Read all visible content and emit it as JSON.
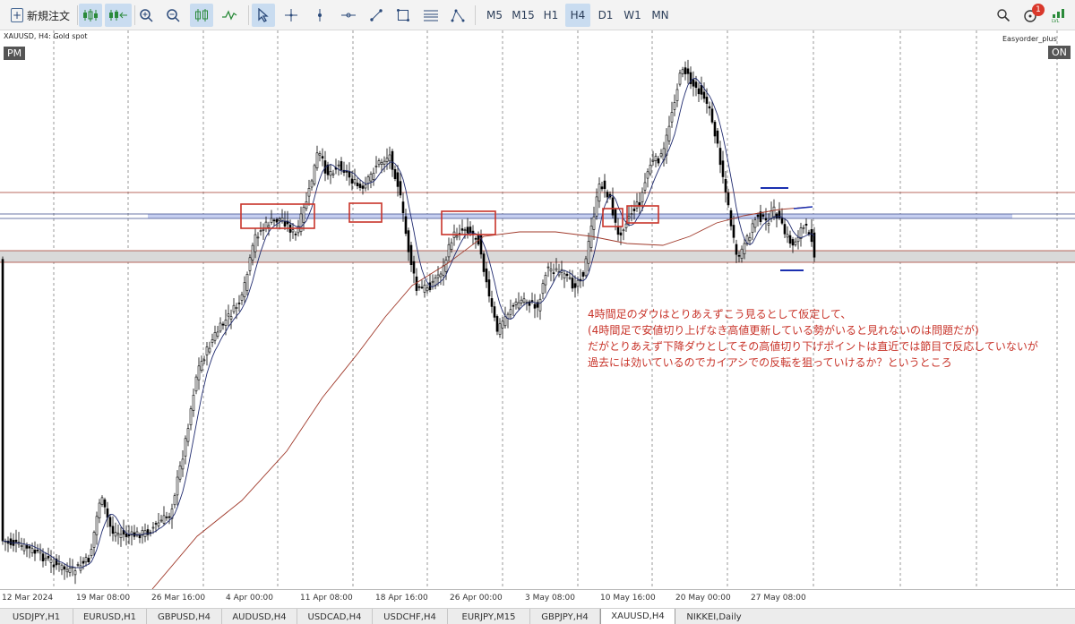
{
  "toolbar": {
    "new_order_label": "新規注文",
    "timeframes": [
      "M5",
      "M15",
      "H1",
      "H4",
      "D1",
      "W1",
      "MN"
    ],
    "active_timeframe": "H4",
    "notification_count": "1",
    "tools": [
      "depth-of-market-icon",
      "one-click-trading-icon",
      "zoom-in-icon",
      "zoom-out-icon",
      "candlestick-icon",
      "line-chart-icon",
      "cursor-icon",
      "crosshair-icon",
      "vertical-line-icon",
      "horizontal-line-icon",
      "trendline-icon",
      "rectangle-icon",
      "fibonacci-icon",
      "shapes-icon",
      "search-icon",
      "notifications-icon",
      "signal-strength-icon"
    ]
  },
  "chart": {
    "symbol_label": "XAUUSD, H4:  Gold spot",
    "pm_badge": "PM",
    "on_badge": "ON",
    "ea_label": "Easyorder_plus",
    "annotation": [
      "4時間足のダウはとりあえずこう見るとして仮定して、",
      "(4時間足で安値切り上げなき高値更新している勢がいると見れないのは問題だが)",
      "だがとりあえず下降ダウとしてその高値切り下げポイントは直近では節目で反応していないが",
      "過去には効いているのでカイアシでの反転を狙っていけるか？というところ"
    ],
    "dates": [
      "12 Mar 2024",
      "19 Mar 08:00",
      "26 Mar 16:00",
      "4 Apr 00:00",
      "11 Apr 08:00",
      "18 Apr 16:00",
      "26 Apr 00:00",
      "3 May 08:00",
      "10 May 16:00",
      "20 May 00:00",
      "27 May 08:00"
    ],
    "colors": {
      "candle": "#000000",
      "ma_fast": "#1f2a6e",
      "ma_slow": "#a0392a",
      "annotation": "#c8342a",
      "zone_blue": "#c6cff0",
      "zone_gray": "#d9d9d9"
    }
  },
  "tabs": {
    "items": [
      "USDJPY,H1",
      "EURUSD,H1",
      "GBPUSD,H4",
      "AUDUSD,H4",
      "USDCAD,H4",
      "USDCHF,H4",
      "EURJPY,M15",
      "GBPJPY,H4",
      "XAUUSD,H4",
      "NIKKEI,Daily"
    ],
    "active": "XAUUSD,H4"
  }
}
